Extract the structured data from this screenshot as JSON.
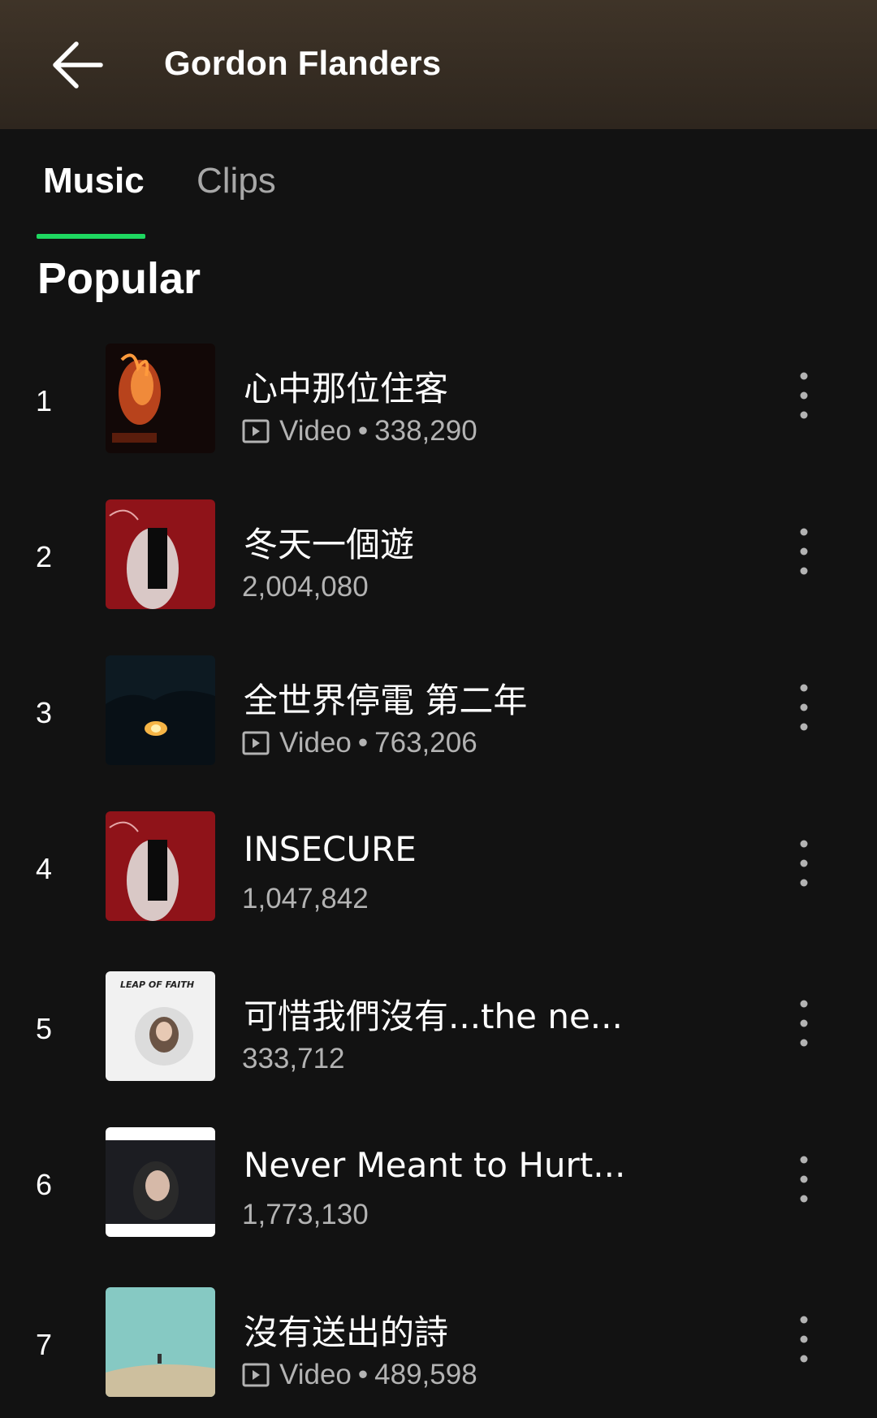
{
  "header": {
    "title": "Gordon Flanders",
    "back_icon": "arrow-left-icon"
  },
  "tabs": [
    {
      "label": "Music",
      "active": true
    },
    {
      "label": "Clips",
      "active": false
    }
  ],
  "colors": {
    "accent": "#1ed760",
    "background": "#121212",
    "header_bg": "#3f3428",
    "secondary_text": "#b3b3b3"
  },
  "section_title": "Popular",
  "tracks": [
    {
      "rank": "1",
      "title": "心中那位住客",
      "has_video": true,
      "video_label": "Video",
      "plays": "338,290"
    },
    {
      "rank": "2",
      "title": "冬天一個遊",
      "has_video": false,
      "plays": "2,004,080"
    },
    {
      "rank": "3",
      "title": "全世界停電 第二年",
      "has_video": true,
      "video_label": "Video",
      "plays": "763,206"
    },
    {
      "rank": "4",
      "title": "INSECURE",
      "has_video": false,
      "plays": "1,047,842"
    },
    {
      "rank": "5",
      "title": "可惜我們沒有...the ne...",
      "has_video": false,
      "plays": "333,712",
      "cover_text": "LEAP OF FAITH"
    },
    {
      "rank": "6",
      "title": "Never Meant to Hurt...",
      "has_video": false,
      "plays": "1,773,130"
    },
    {
      "rank": "7",
      "title": "沒有送出的詩",
      "has_video": true,
      "video_label": "Video",
      "plays": "489,598"
    }
  ]
}
